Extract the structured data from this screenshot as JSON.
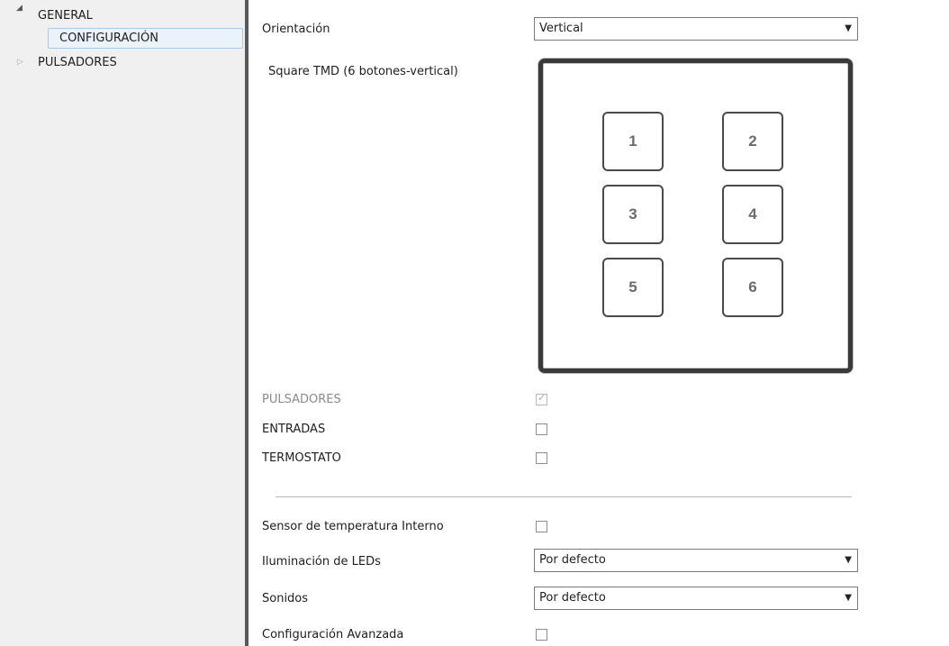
{
  "tree": {
    "general": {
      "label": "GENERAL",
      "arrow": "◢"
    },
    "configuracion": {
      "label": "CONFIGURACIÓN"
    },
    "pulsadores": {
      "label": "PULSADORES",
      "arrow": "▷"
    }
  },
  "params": {
    "orientacion": {
      "label": "Orientación",
      "value": "Vertical"
    },
    "device": {
      "caption": "Square TMD (6 botones-vertical)",
      "buttons": [
        "1",
        "2",
        "3",
        "4",
        "5",
        "6"
      ]
    },
    "pulsadores": {
      "label": "PULSADORES",
      "checked": true,
      "disabled": true
    },
    "entradas": {
      "label": "ENTRADAS",
      "checked": false
    },
    "termostato": {
      "label": "TERMOSTATO",
      "checked": false
    },
    "sensor": {
      "label": "Sensor de temperatura Interno",
      "checked": false
    },
    "iluminacion": {
      "label": "Iluminación de LEDs",
      "value": "Por defecto"
    },
    "sonidos": {
      "label": "Sonidos",
      "value": "Por defecto"
    },
    "avanzada": {
      "label": "Configuración Avanzada",
      "checked": false
    }
  },
  "icons": {
    "dropdown_arrow": "▼",
    "check_mark": "✓"
  }
}
